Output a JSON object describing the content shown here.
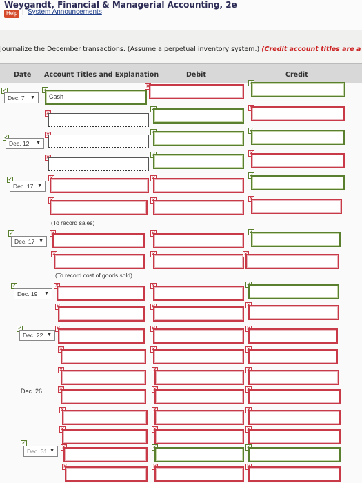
{
  "header": {
    "book_title": "Weygandt, Financial & Managerial Accounting, 2e",
    "help_label": "Help",
    "separator": "|",
    "announcements_link": "System Announcements"
  },
  "instruction": {
    "text": "Journalize the December transactions. (Assume a perpetual inventory system.)",
    "red_text": "(Credit account titles are a"
  },
  "columns": {
    "date": "Date",
    "account": "Account Titles and Explanation",
    "debit": "Debit",
    "credit": "Credit"
  },
  "entries": {
    "e1": {
      "date": "Dec. 7",
      "account_value": "Cash"
    },
    "e2": {
      "date": "Dec. 12"
    },
    "e3": {
      "date": "Dec. 17",
      "note": "(To record sales)"
    },
    "e4": {
      "date": "Dec. 17",
      "note": "(To record cost of goods sold)"
    },
    "e5": {
      "date": "Dec. 19"
    },
    "e6": {
      "date": "Dec. 22"
    },
    "e7": {
      "date": "Dec. 26"
    },
    "e8": {
      "date": "Dec. 31"
    }
  },
  "icons": {
    "incorrect": "x-mark-icon",
    "correct": "check-mark-icon",
    "dropdown": "caret-down-icon"
  },
  "glyphs": {
    "x": "✕",
    "check": "✓",
    "caret": "▼"
  },
  "colors": {
    "incorrect_border": "#c93a49",
    "correct_border": "#5a7f2f",
    "header_bg": "#d8d8d8",
    "link": "#1f3f8a",
    "instruction_red": "#cc2222"
  }
}
